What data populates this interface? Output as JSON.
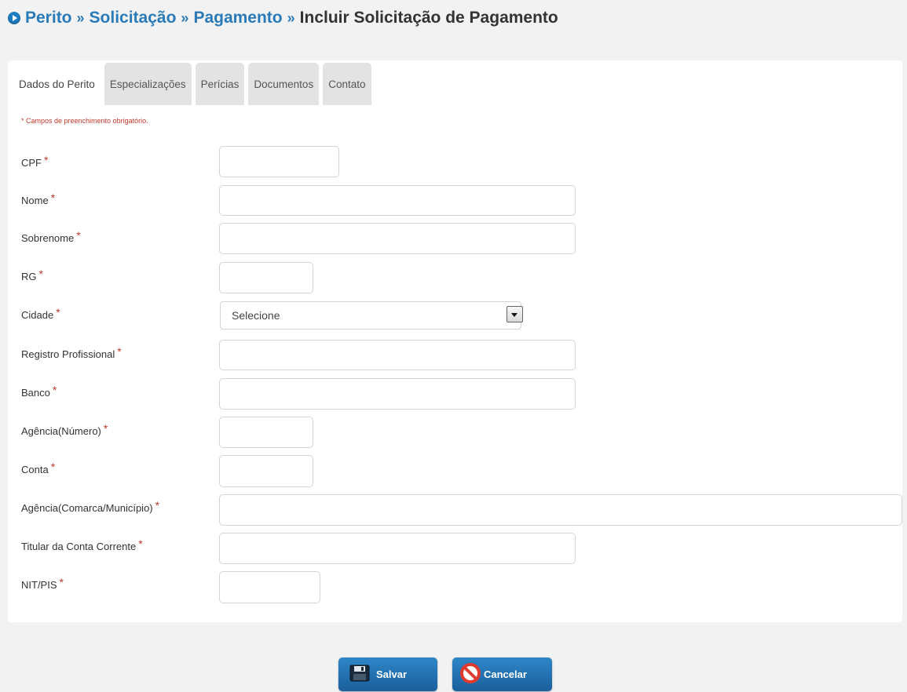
{
  "breadcrumb": {
    "items": [
      "Perito",
      "Solicitação",
      "Pagamento"
    ],
    "separator": "»",
    "current": "Incluir Solicitação de Pagamento"
  },
  "tabs": [
    {
      "label": "Dados do Perito",
      "active": true
    },
    {
      "label": "Especializações",
      "active": false
    },
    {
      "label": "Perícias",
      "active": false
    },
    {
      "label": "Documentos",
      "active": false
    },
    {
      "label": "Contato",
      "active": false
    }
  ],
  "form": {
    "required_note": "* Campos de preenchimento obrigatório.",
    "required_mark": "*",
    "fields": {
      "cpf": {
        "label": "CPF",
        "value": ""
      },
      "nome": {
        "label": "Nome",
        "value": ""
      },
      "sobrenome": {
        "label": "Sobrenome",
        "value": ""
      },
      "rg": {
        "label": "RG",
        "value": ""
      },
      "cidade": {
        "label": "Cidade",
        "selected": "Selecione"
      },
      "registro": {
        "label": "Registro Profissional",
        "value": ""
      },
      "banco": {
        "label": "Banco",
        "value": ""
      },
      "agencia_numero": {
        "label": "Agência(Número)",
        "value": ""
      },
      "conta": {
        "label": "Conta",
        "value": ""
      },
      "agencia_comarca": {
        "label": "Agência(Comarca/Município)",
        "value": ""
      },
      "titular": {
        "label": "Titular da Conta Corrente",
        "value": ""
      },
      "nit_pis": {
        "label": "NIT/PIS",
        "value": ""
      }
    }
  },
  "actions": {
    "save_label": "Salvar",
    "cancel_label": "Cancelar"
  },
  "colors": {
    "link": "#2a7ab8",
    "required": "#c0392b",
    "button": "#1f6fb0",
    "cancel_icon": "#e03a2f"
  }
}
